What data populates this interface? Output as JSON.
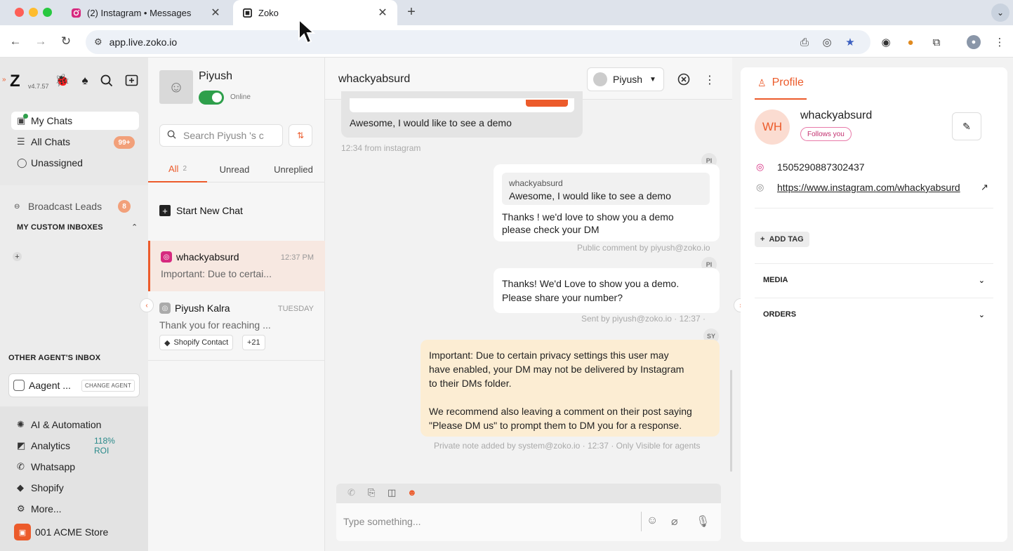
{
  "browser": {
    "tabs": [
      {
        "title": "(2) Instagram • Messages",
        "active": false
      },
      {
        "title": "Zoko",
        "active": true
      }
    ],
    "url": "app.live.zoko.io"
  },
  "leftnav": {
    "version": "v4.7.57",
    "items": [
      {
        "label": "My Chats",
        "active": true
      },
      {
        "label": "All Chats",
        "badge": "99+"
      },
      {
        "label": "Unassigned"
      }
    ],
    "broadcast": {
      "label": "Broadcast Leads",
      "badge": "8"
    },
    "custom_inboxes_label": "MY CUSTOM INBOXES",
    "other_agents_label": "OTHER AGENT'S INBOX",
    "agent_name": "Aagent ...",
    "change_agent_label": "CHANGE AGENT",
    "bottom_items": [
      {
        "label": "AI & Automation"
      },
      {
        "label": "Analytics",
        "extra": "118% ROI"
      },
      {
        "label": "Whatsapp"
      },
      {
        "label": "Shopify"
      },
      {
        "label": "More..."
      }
    ],
    "store_name": "001 ACME Store"
  },
  "chatlist": {
    "agent_name": "Piyush",
    "status": "Online",
    "search_placeholder": "Search Piyush 's c",
    "tabs": [
      {
        "label": "All",
        "count": "2",
        "active": true
      },
      {
        "label": "Unread"
      },
      {
        "label": "Unreplied"
      }
    ],
    "start_new_chat": "Start New Chat",
    "chats": [
      {
        "name": "whackyabsurd",
        "time": "12:37 PM",
        "preview": "Important: Due to certai...",
        "active": true
      },
      {
        "name": "Piyush Kalra",
        "time": "TUESDAY",
        "preview": "Thank you for reaching ...",
        "tags": [
          "Shopify Contact",
          "+21"
        ]
      }
    ]
  },
  "conversation": {
    "title": "whackyabsurd",
    "assignee": "Piyush",
    "messages": [
      {
        "type": "in",
        "text": "Awesome, I would like to see a demo",
        "meta": "12:34 from instagram"
      },
      {
        "type": "out",
        "avatar": "PI",
        "quote_author": "whackyabsurd",
        "quote_text": "Awesome, I would like to see a demo",
        "lines": [
          "Thanks ! we'd love to show you a demo",
          "please check your DM"
        ],
        "meta": "Public comment by piyush@zoko.io"
      },
      {
        "type": "out",
        "avatar": "PI",
        "lines": [
          "Thanks! We'd Love to show you a demo.",
          "Please share your number?"
        ],
        "meta": "Sent by piyush@zoko.io · 12:37 ·"
      },
      {
        "type": "note",
        "avatar": "SY",
        "lines": [
          "Important: Due to certain privacy settings this user may",
          "have enabled, your DM may not be delivered by Instagram",
          "to their DMs folder.",
          "",
          "We recommend also leaving a comment on their post saying",
          "\"Please DM us\" to prompt them to DM you for a response."
        ],
        "meta": "Private note added by system@zoko.io · 12:37 · Only Visible for agents"
      }
    ],
    "composer_placeholder": "Type something..."
  },
  "profile": {
    "tab_label": "Profile",
    "initials": "WH",
    "name": "whackyabsurd",
    "follows_label": "Follows you",
    "instagram_id": "1505290887302437",
    "instagram_url": "https://www.instagram.com/whackyabsurd",
    "add_tag_label": "ADD TAG",
    "sections": [
      "MEDIA",
      "ORDERS"
    ]
  },
  "colors": {
    "accent": "#ec5b2b",
    "online": "#2e9f4b",
    "note_bg": "#fcedd3"
  }
}
